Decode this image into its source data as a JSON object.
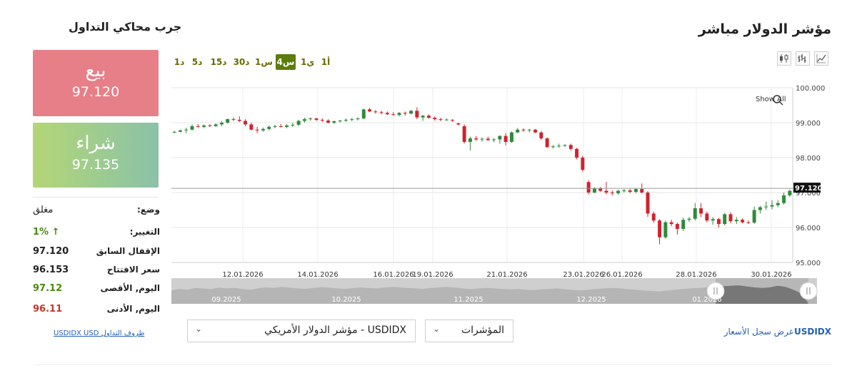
{
  "header": {
    "title": "مؤشر الدولار مباشر",
    "side_title": "جرب محاكي التداول"
  },
  "timeframes": [
    "1أ",
    "1ي",
    "4س",
    "1س",
    "30د",
    "15د",
    "5د",
    "1د"
  ],
  "active_timeframe": "4س",
  "chart_tools": [
    "candlestick-chart-icon",
    "bar-chart-icon",
    "line-chart-icon"
  ],
  "chart": {
    "show_all_label": "Show All",
    "current_price_tag": "97.120",
    "y_ticks": [
      "100.000",
      "99.000",
      "98.000",
      "97.000",
      "96.000",
      "95.000"
    ],
    "x_ticks": [
      "12.01.2026",
      "14.01.2026",
      "16.01.2026",
      "19.01.2026",
      "21.01.2026",
      "23.01.2026",
      "26.01.2026",
      "28.01.2026",
      "30.01.2026"
    ],
    "navigator_labels": [
      "09.2025",
      "10.2025",
      "11.2025",
      "12.2025",
      "01.2026"
    ],
    "up_color": "#2e8b3a",
    "down_color": "#d0232e"
  },
  "chart_data": {
    "type": "candlestick",
    "ylim": [
      95,
      100
    ],
    "current": 97.12,
    "ohlc": [
      [
        98.72,
        98.76,
        98.69,
        98.74
      ],
      [
        98.74,
        98.8,
        98.72,
        98.78
      ],
      [
        98.78,
        98.85,
        98.7,
        98.8
      ],
      [
        98.8,
        98.95,
        98.78,
        98.9
      ],
      [
        98.9,
        98.96,
        98.85,
        98.88
      ],
      [
        98.88,
        98.95,
        98.84,
        98.92
      ],
      [
        98.92,
        98.96,
        98.88,
        98.9
      ],
      [
        98.9,
        98.98,
        98.88,
        98.95
      ],
      [
        98.95,
        99.05,
        98.9,
        99.0
      ],
      [
        99.0,
        99.12,
        98.97,
        99.1
      ],
      [
        99.1,
        99.15,
        99.05,
        99.08
      ],
      [
        99.08,
        99.18,
        99.02,
        99.05
      ],
      [
        99.05,
        99.1,
        98.9,
        98.95
      ],
      [
        98.95,
        99.0,
        98.78,
        98.8
      ],
      [
        98.8,
        98.88,
        98.7,
        98.78
      ],
      [
        98.78,
        98.86,
        98.74,
        98.82
      ],
      [
        98.82,
        98.92,
        98.78,
        98.88
      ],
      [
        98.88,
        98.94,
        98.84,
        98.9
      ],
      [
        98.9,
        98.96,
        98.86,
        98.88
      ],
      [
        98.88,
        98.96,
        98.84,
        98.92
      ],
      [
        98.92,
        99.0,
        98.88,
        98.94
      ],
      [
        98.94,
        99.08,
        98.9,
        99.05
      ],
      [
        99.05,
        99.14,
        99.0,
        99.1
      ],
      [
        99.1,
        99.15,
        99.06,
        99.12
      ],
      [
        99.12,
        99.14,
        99.05,
        99.08
      ],
      [
        99.08,
        99.12,
        99.02,
        99.06
      ],
      [
        99.06,
        99.1,
        98.98,
        99.0
      ],
      [
        99.0,
        99.06,
        98.96,
        99.04
      ],
      [
        99.04,
        99.08,
        99.0,
        99.06
      ],
      [
        99.06,
        99.12,
        99.02,
        99.08
      ],
      [
        99.08,
        99.14,
        99.04,
        99.1
      ],
      [
        99.1,
        99.15,
        99.06,
        99.12
      ],
      [
        99.12,
        99.4,
        99.1,
        99.38
      ],
      [
        99.38,
        99.42,
        99.3,
        99.32
      ],
      [
        99.32,
        99.36,
        99.26,
        99.3
      ],
      [
        99.3,
        99.34,
        99.24,
        99.28
      ],
      [
        99.28,
        99.32,
        99.22,
        99.24
      ],
      [
        99.24,
        99.3,
        99.2,
        99.22
      ],
      [
        99.22,
        99.3,
        99.18,
        99.28
      ],
      [
        99.28,
        99.32,
        99.2,
        99.26
      ],
      [
        99.26,
        99.36,
        99.24,
        99.34
      ],
      [
        99.34,
        99.44,
        99.1,
        99.15
      ],
      [
        99.15,
        99.22,
        99.05,
        99.2
      ],
      [
        99.2,
        99.24,
        99.12,
        99.14
      ],
      [
        99.14,
        99.18,
        99.06,
        99.1
      ],
      [
        99.1,
        99.14,
        99.04,
        99.08
      ],
      [
        99.08,
        99.12,
        99.05,
        99.09
      ],
      [
        99.08,
        99.1,
        99.02,
        99.06
      ],
      [
        98.98,
        99.0,
        98.92,
        98.95
      ],
      [
        98.9,
        98.95,
        98.4,
        98.45
      ],
      [
        98.45,
        98.6,
        98.2,
        98.55
      ],
      [
        98.55,
        98.62,
        98.48,
        98.52
      ],
      [
        98.52,
        98.58,
        98.46,
        98.54
      ],
      [
        98.54,
        98.6,
        98.48,
        98.5
      ],
      [
        98.5,
        98.56,
        98.44,
        98.52
      ],
      [
        98.52,
        98.64,
        98.4,
        98.62
      ],
      [
        98.62,
        98.7,
        98.35,
        98.45
      ],
      [
        98.45,
        98.75,
        98.42,
        98.72
      ],
      [
        98.72,
        98.85,
        98.7,
        98.8
      ],
      [
        98.8,
        98.84,
        98.74,
        98.78
      ],
      [
        98.78,
        98.82,
        98.72,
        98.8
      ],
      [
        98.8,
        98.82,
        98.7,
        98.72
      ],
      [
        98.72,
        98.76,
        98.5,
        98.55
      ],
      [
        98.55,
        98.58,
        98.28,
        98.3
      ],
      [
        98.3,
        98.36,
        98.26,
        98.32
      ],
      [
        98.32,
        98.4,
        98.28,
        98.34
      ],
      [
        98.34,
        98.38,
        98.3,
        98.36
      ],
      [
        98.36,
        98.4,
        98.2,
        98.25
      ],
      [
        98.25,
        98.28,
        97.95,
        98.0
      ],
      [
        98.0,
        98.05,
        97.6,
        97.65
      ],
      [
        97.3,
        97.35,
        96.95,
        97.0
      ],
      [
        97.0,
        97.15,
        96.98,
        97.12
      ],
      [
        97.12,
        97.16,
        97.02,
        97.05
      ],
      [
        97.05,
        97.3,
        96.95,
        97.0
      ],
      [
        97.0,
        97.06,
        96.92,
        96.98
      ],
      [
        96.98,
        97.08,
        96.94,
        97.05
      ],
      [
        97.05,
        97.1,
        97.0,
        97.06
      ],
      [
        97.06,
        97.12,
        96.98,
        97.02
      ],
      [
        97.02,
        97.12,
        96.98,
        97.1
      ],
      [
        97.1,
        97.26,
        96.98,
        97.0
      ],
      [
        97.0,
        97.04,
        96.3,
        96.4
      ],
      [
        96.4,
        96.46,
        96.14,
        96.2
      ],
      [
        96.2,
        96.24,
        95.52,
        95.72
      ],
      [
        95.72,
        96.2,
        95.68,
        96.15
      ],
      [
        96.15,
        96.22,
        96.04,
        96.1
      ],
      [
        96.1,
        96.14,
        95.8,
        95.96
      ],
      [
        95.96,
        96.28,
        95.9,
        96.22
      ],
      [
        96.22,
        96.3,
        96.16,
        96.25
      ],
      [
        96.25,
        96.7,
        96.2,
        96.55
      ],
      [
        96.55,
        96.7,
        96.3,
        96.4
      ],
      [
        96.4,
        96.46,
        96.15,
        96.2
      ],
      [
        96.2,
        96.3,
        96.08,
        96.24
      ],
      [
        96.24,
        96.28,
        96.0,
        96.1
      ],
      [
        96.1,
        96.42,
        96.06,
        96.38
      ],
      [
        96.38,
        96.44,
        96.12,
        96.18
      ],
      [
        96.18,
        96.3,
        96.1,
        96.22
      ],
      [
        96.22,
        96.26,
        96.12,
        96.15
      ],
      [
        96.15,
        96.2,
        96.1,
        96.14
      ],
      [
        96.14,
        96.6,
        96.1,
        96.5
      ],
      [
        96.5,
        96.62,
        96.4,
        96.58
      ],
      [
        96.58,
        96.74,
        96.5,
        96.6
      ],
      [
        96.6,
        96.78,
        96.52,
        96.64
      ],
      [
        96.64,
        96.78,
        96.58,
        96.7
      ],
      [
        96.7,
        97.0,
        96.66,
        96.92
      ],
      [
        96.92,
        97.08,
        96.88,
        97.05
      ]
    ],
    "navigator_profile": [
      0.52,
      0.58,
      0.55,
      0.62,
      0.6,
      0.57,
      0.63,
      0.6,
      0.62,
      0.58,
      0.55,
      0.6,
      0.64,
      0.62,
      0.66,
      0.63,
      0.6,
      0.58,
      0.62,
      0.65,
      0.63,
      0.6,
      0.58,
      0.61,
      0.64,
      0.62,
      0.6,
      0.63,
      0.66,
      0.64,
      0.62,
      0.6,
      0.58,
      0.62,
      0.64,
      0.66,
      0.63,
      0.6,
      0.57,
      0.6,
      0.62,
      0.6,
      0.58,
      0.56,
      0.58,
      0.55,
      0.53,
      0.56,
      0.58,
      0.6,
      0.57,
      0.54,
      0.52,
      0.55,
      0.58,
      0.6,
      0.62,
      0.6,
      0.57,
      0.55,
      0.52,
      0.5,
      0.48,
      0.52,
      0.55,
      0.58,
      0.6,
      0.62,
      0.64,
      0.66,
      0.68,
      0.7,
      0.72,
      0.68,
      0.64,
      0.62,
      0.64,
      0.7,
      0.66,
      0.55,
      0.4,
      0.3,
      0.28
    ]
  },
  "sell": {
    "label": "بيع",
    "price": "97.120",
    "color": "#e67f87"
  },
  "buy": {
    "label": "شراء",
    "price": "97.135"
  },
  "info": [
    {
      "label": "وضع:",
      "value": "مغلق",
      "color": "#222222"
    },
    {
      "label": "التغيير:",
      "value": "1% ↑",
      "color": "#4a8a13"
    },
    {
      "label": "الإقفال السابق",
      "value": "97.120",
      "color": "#222222"
    },
    {
      "label": "سعر الافتتاح",
      "value": "96.153",
      "color": "#222222"
    },
    {
      "label": "اليوم, الأقصى",
      "value": "97.12",
      "color": "#4a8a13"
    },
    {
      "label": "اليوم, الأدنى",
      "value": "96.11",
      "color": "#c0392b"
    }
  ],
  "links": {
    "trading_conditions": "USDIDX USD ظروف التداول",
    "price_history_prefix": "USDIDX",
    "price_history": "عرض سجل الأسعار"
  },
  "selects": {
    "instrument": "USDIDX - مؤشر الدولار الأمريكي",
    "category": "المؤشرات"
  }
}
